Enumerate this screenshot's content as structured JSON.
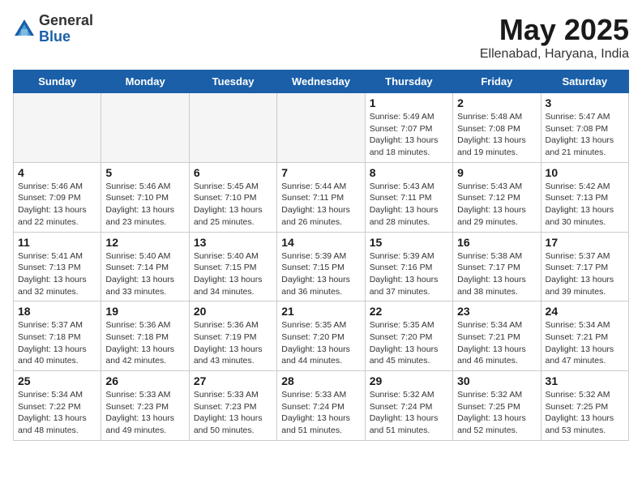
{
  "logo": {
    "general": "General",
    "blue": "Blue"
  },
  "title": {
    "month": "May 2025",
    "location": "Ellenabad, Haryana, India"
  },
  "days_of_week": [
    "Sunday",
    "Monday",
    "Tuesday",
    "Wednesday",
    "Thursday",
    "Friday",
    "Saturday"
  ],
  "weeks": [
    [
      {
        "day": "",
        "info": ""
      },
      {
        "day": "",
        "info": ""
      },
      {
        "day": "",
        "info": ""
      },
      {
        "day": "",
        "info": ""
      },
      {
        "day": "1",
        "info": "Sunrise: 5:49 AM\nSunset: 7:07 PM\nDaylight: 13 hours\nand 18 minutes."
      },
      {
        "day": "2",
        "info": "Sunrise: 5:48 AM\nSunset: 7:08 PM\nDaylight: 13 hours\nand 19 minutes."
      },
      {
        "day": "3",
        "info": "Sunrise: 5:47 AM\nSunset: 7:08 PM\nDaylight: 13 hours\nand 21 minutes."
      }
    ],
    [
      {
        "day": "4",
        "info": "Sunrise: 5:46 AM\nSunset: 7:09 PM\nDaylight: 13 hours\nand 22 minutes."
      },
      {
        "day": "5",
        "info": "Sunrise: 5:46 AM\nSunset: 7:10 PM\nDaylight: 13 hours\nand 23 minutes."
      },
      {
        "day": "6",
        "info": "Sunrise: 5:45 AM\nSunset: 7:10 PM\nDaylight: 13 hours\nand 25 minutes."
      },
      {
        "day": "7",
        "info": "Sunrise: 5:44 AM\nSunset: 7:11 PM\nDaylight: 13 hours\nand 26 minutes."
      },
      {
        "day": "8",
        "info": "Sunrise: 5:43 AM\nSunset: 7:11 PM\nDaylight: 13 hours\nand 28 minutes."
      },
      {
        "day": "9",
        "info": "Sunrise: 5:43 AM\nSunset: 7:12 PM\nDaylight: 13 hours\nand 29 minutes."
      },
      {
        "day": "10",
        "info": "Sunrise: 5:42 AM\nSunset: 7:13 PM\nDaylight: 13 hours\nand 30 minutes."
      }
    ],
    [
      {
        "day": "11",
        "info": "Sunrise: 5:41 AM\nSunset: 7:13 PM\nDaylight: 13 hours\nand 32 minutes."
      },
      {
        "day": "12",
        "info": "Sunrise: 5:40 AM\nSunset: 7:14 PM\nDaylight: 13 hours\nand 33 minutes."
      },
      {
        "day": "13",
        "info": "Sunrise: 5:40 AM\nSunset: 7:15 PM\nDaylight: 13 hours\nand 34 minutes."
      },
      {
        "day": "14",
        "info": "Sunrise: 5:39 AM\nSunset: 7:15 PM\nDaylight: 13 hours\nand 36 minutes."
      },
      {
        "day": "15",
        "info": "Sunrise: 5:39 AM\nSunset: 7:16 PM\nDaylight: 13 hours\nand 37 minutes."
      },
      {
        "day": "16",
        "info": "Sunrise: 5:38 AM\nSunset: 7:17 PM\nDaylight: 13 hours\nand 38 minutes."
      },
      {
        "day": "17",
        "info": "Sunrise: 5:37 AM\nSunset: 7:17 PM\nDaylight: 13 hours\nand 39 minutes."
      }
    ],
    [
      {
        "day": "18",
        "info": "Sunrise: 5:37 AM\nSunset: 7:18 PM\nDaylight: 13 hours\nand 40 minutes."
      },
      {
        "day": "19",
        "info": "Sunrise: 5:36 AM\nSunset: 7:18 PM\nDaylight: 13 hours\nand 42 minutes."
      },
      {
        "day": "20",
        "info": "Sunrise: 5:36 AM\nSunset: 7:19 PM\nDaylight: 13 hours\nand 43 minutes."
      },
      {
        "day": "21",
        "info": "Sunrise: 5:35 AM\nSunset: 7:20 PM\nDaylight: 13 hours\nand 44 minutes."
      },
      {
        "day": "22",
        "info": "Sunrise: 5:35 AM\nSunset: 7:20 PM\nDaylight: 13 hours\nand 45 minutes."
      },
      {
        "day": "23",
        "info": "Sunrise: 5:34 AM\nSunset: 7:21 PM\nDaylight: 13 hours\nand 46 minutes."
      },
      {
        "day": "24",
        "info": "Sunrise: 5:34 AM\nSunset: 7:21 PM\nDaylight: 13 hours\nand 47 minutes."
      }
    ],
    [
      {
        "day": "25",
        "info": "Sunrise: 5:34 AM\nSunset: 7:22 PM\nDaylight: 13 hours\nand 48 minutes."
      },
      {
        "day": "26",
        "info": "Sunrise: 5:33 AM\nSunset: 7:23 PM\nDaylight: 13 hours\nand 49 minutes."
      },
      {
        "day": "27",
        "info": "Sunrise: 5:33 AM\nSunset: 7:23 PM\nDaylight: 13 hours\nand 50 minutes."
      },
      {
        "day": "28",
        "info": "Sunrise: 5:33 AM\nSunset: 7:24 PM\nDaylight: 13 hours\nand 51 minutes."
      },
      {
        "day": "29",
        "info": "Sunrise: 5:32 AM\nSunset: 7:24 PM\nDaylight: 13 hours\nand 51 minutes."
      },
      {
        "day": "30",
        "info": "Sunrise: 5:32 AM\nSunset: 7:25 PM\nDaylight: 13 hours\nand 52 minutes."
      },
      {
        "day": "31",
        "info": "Sunrise: 5:32 AM\nSunset: 7:25 PM\nDaylight: 13 hours\nand 53 minutes."
      }
    ]
  ]
}
